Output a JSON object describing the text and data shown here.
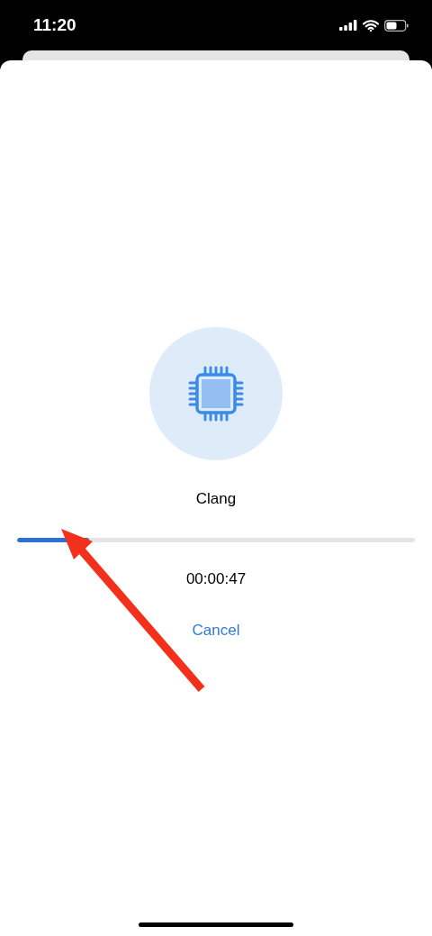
{
  "status_bar": {
    "time": "11:20"
  },
  "task": {
    "name": "Clang",
    "progress": {
      "level": 0.18
    },
    "elapsed": "00:00:47",
    "cancel_label": "Cancel"
  }
}
